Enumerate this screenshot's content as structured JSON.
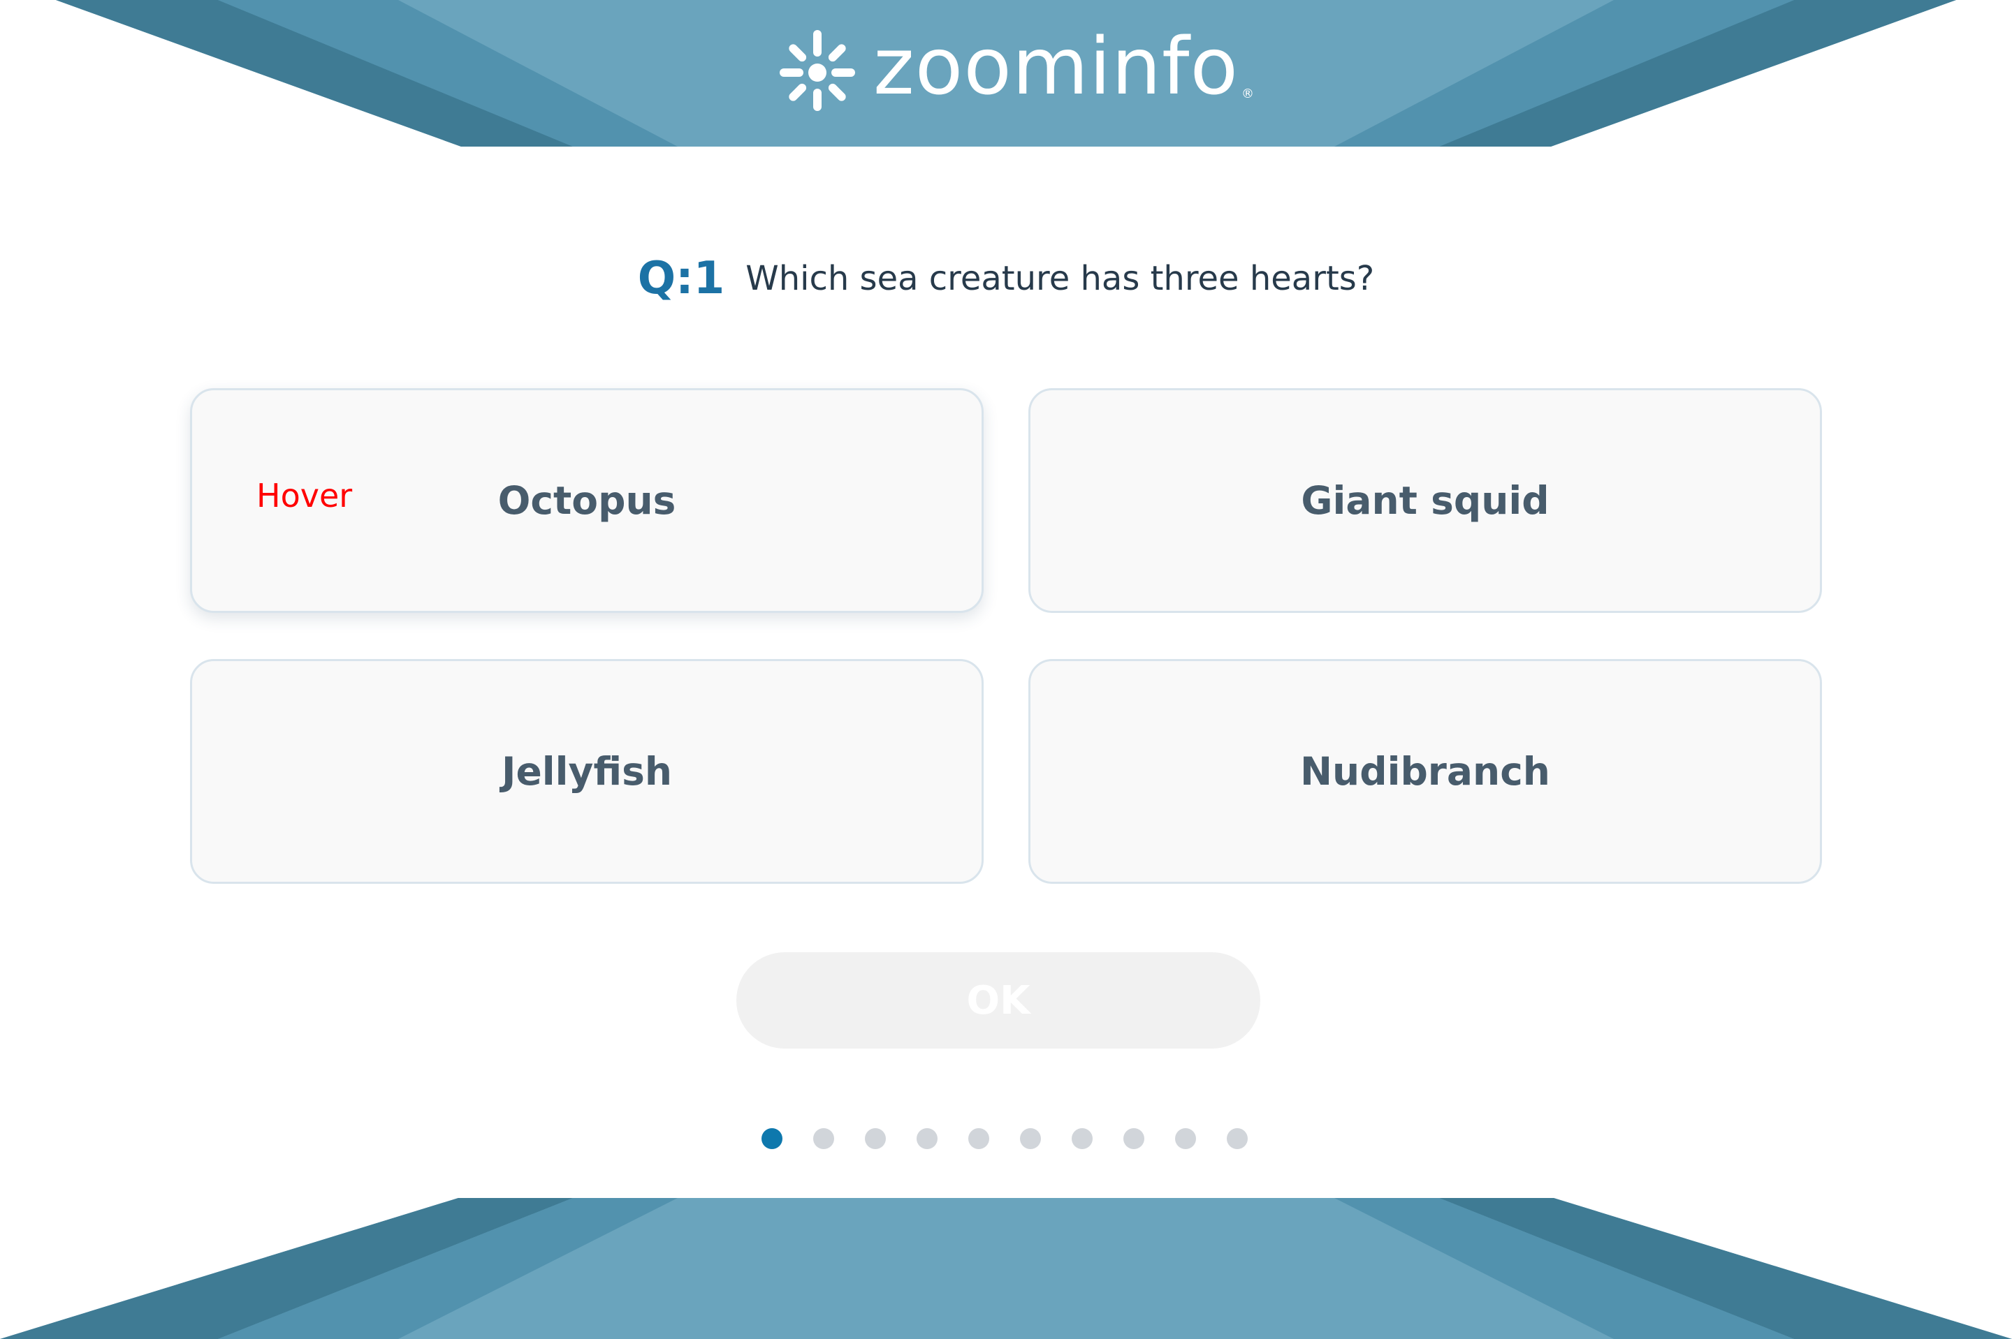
{
  "logo": {
    "name": "zoominfo",
    "registered": "®"
  },
  "question": {
    "number": "Q:1",
    "text": "Which sea creature has three hearts?"
  },
  "options": [
    {
      "label": "Octopus",
      "state": "Hover"
    },
    {
      "label": "Giant squid"
    },
    {
      "label": "Jellyfish"
    },
    {
      "label": "Nudibranch"
    }
  ],
  "ok_button": {
    "label": "OK",
    "enabled": false
  },
  "pagination": {
    "total": 10,
    "current": 1
  },
  "colors": {
    "banner_light": "#6aa4bd",
    "banner_mid": "#5292ae",
    "banner_dark": "#3f7b94",
    "question_number": "#1c72a5",
    "active_dot": "#0e78ad",
    "inactive_dot": "#d1d5da",
    "hover_annotation": "#ff0000"
  }
}
